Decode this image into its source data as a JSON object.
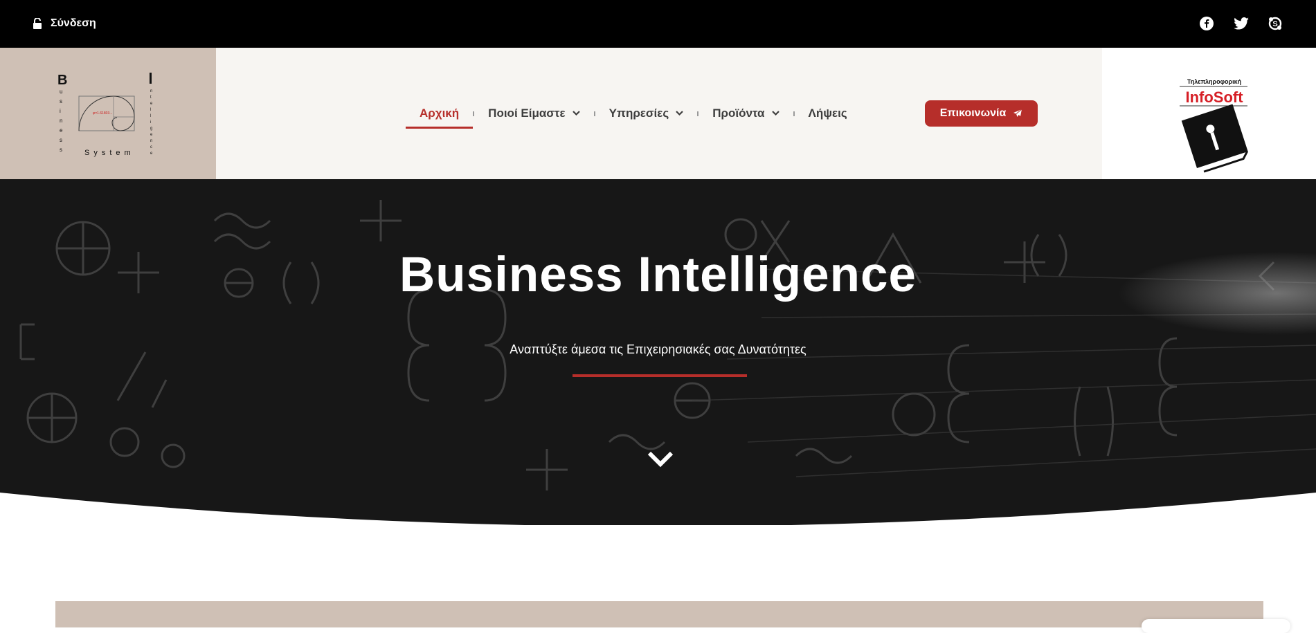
{
  "topbar": {
    "login_label": "Σύνδεση",
    "social": [
      "facebook-icon",
      "twitter-icon",
      "skype-icon"
    ]
  },
  "logo_left": {
    "letter_b": "B",
    "letter_i": "I",
    "word_business": "usiness",
    "word_system": "System",
    "word_intelligence": "ntelligence",
    "phi": "φ=1.61803..."
  },
  "nav": {
    "items": [
      {
        "label": "Αρχική",
        "active": true
      },
      {
        "label": "Ποιοί Είμαστε",
        "dropdown": true
      },
      {
        "label": "Υπηρεσίες",
        "dropdown": true
      },
      {
        "label": "Προϊόντα",
        "dropdown": true
      },
      {
        "label": "Λήψεις"
      }
    ],
    "contact_label": "Επικοινωνία"
  },
  "logo_right": {
    "tagline": "Τηλεπληροφορική",
    "brand": "InfoSoft"
  },
  "hero": {
    "title": "Business Intelligence",
    "subtitle": "Αναπτύξτε άμεσα τις Επιχειρησιακές σας Δυνατότητες"
  },
  "colors": {
    "accent": "#b62e2a",
    "topbar": "#000000",
    "header_bg": "#f7f5f2",
    "logo_bg": "#cfc0b5",
    "hero_bg": "#161616"
  }
}
